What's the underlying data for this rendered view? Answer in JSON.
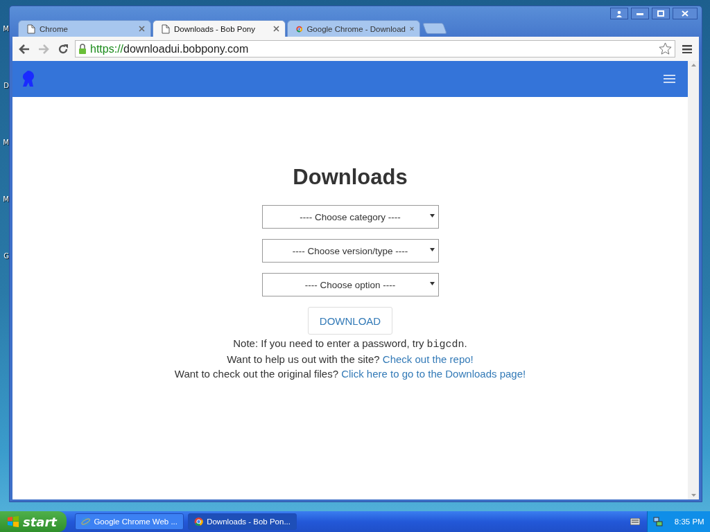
{
  "desktop_labels": [
    "M",
    "D",
    "M",
    "M",
    "G"
  ],
  "window": {
    "tabs": [
      {
        "title": "Chrome",
        "kind": "page",
        "selected": false
      },
      {
        "title": "Downloads - Bob Pony",
        "kind": "page",
        "selected": true
      },
      {
        "title": "Google Chrome - Download",
        "kind": "app",
        "selected": false
      }
    ],
    "address": {
      "scheme": "https://",
      "host": "downloadui.bobpony.com"
    }
  },
  "page": {
    "heading": "Downloads",
    "selects": [
      {
        "text": "---- Choose category ----"
      },
      {
        "text": "---- Choose version/type ----"
      },
      {
        "text": "---- Choose option ----"
      }
    ],
    "button": "DOWNLOAD",
    "note": {
      "before": "Note: If you need to enter a password, try ",
      "code": "bigcdn",
      "after": "."
    },
    "lines": [
      {
        "text": "Want to help us out with the site? ",
        "link": "Check out the repo!"
      },
      {
        "text": "Want to check out the original files? ",
        "link": "Click here to go to the Downloads page!"
      }
    ]
  },
  "taskbar": {
    "start": "start",
    "tasks": [
      {
        "title": "Google Chrome Web ...",
        "kind": "web",
        "selected": false
      },
      {
        "title": "Downloads - Bob Pon...",
        "kind": "app",
        "selected": true
      }
    ],
    "clock": "8:35 PM"
  }
}
